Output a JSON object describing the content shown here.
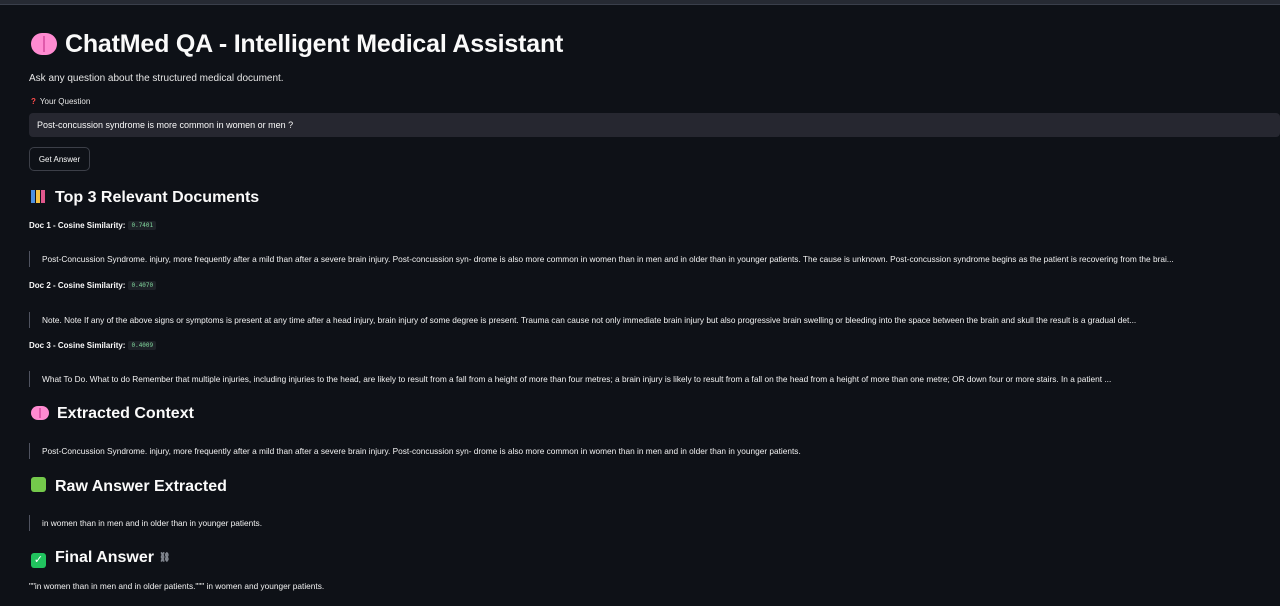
{
  "header": {
    "title": "ChatMed QA - Intelligent Medical Assistant",
    "subtitle": "Ask any question about the structured medical document."
  },
  "question": {
    "label": "Your Question",
    "value": "Post-concussion syndrome is more common in women or men ?"
  },
  "get_answer_label": "Get Answer",
  "docs_section": {
    "title": "Top 3 Relevant Documents",
    "docs": [
      {
        "label": "Doc 1 - Cosine Similarity:",
        "score": "0.7401",
        "text": "Post-Concussion Syndrome. injury, more frequently after a mild than after a severe brain injury. Post-concussion syn- drome is also more common in women than in men and in older than in younger patients. The cause is unknown. Post-concussion syndrome begins as the patient is recovering from the brai..."
      },
      {
        "label": "Doc 2 - Cosine Similarity:",
        "score": "0.4070",
        "text": "Note. Note If any of the above signs or symptoms is present at any time after a head injury, brain injury of some degree is present. Trauma can cause not only immediate brain injury but also progressive brain swelling or bleeding into the space between the brain and skull the result is a gradual det..."
      },
      {
        "label": "Doc 3 - Cosine Similarity:",
        "score": "0.4009",
        "text": "What To Do. What to do Remember that multiple injuries, including injuries to the head, are likely to result from a fall from a height of more than four metres; a brain injury is likely to result from a fall on the head from a height of more than one metre; OR down four or more stairs. In a patient ..."
      }
    ]
  },
  "context_section": {
    "title": "Extracted Context",
    "text": "Post-Concussion Syndrome. injury, more frequently after a mild than after a severe brain injury. Post-concussion syn- drome is also more common in women than in men and in older than in younger patients."
  },
  "raw_section": {
    "title": "Raw Answer Extracted",
    "text": "in women than in men and in older than in younger patients."
  },
  "final_section": {
    "title": "Final Answer",
    "text": "\"\"in women than in men and in older patients.\"\"\" in women and younger patients."
  }
}
